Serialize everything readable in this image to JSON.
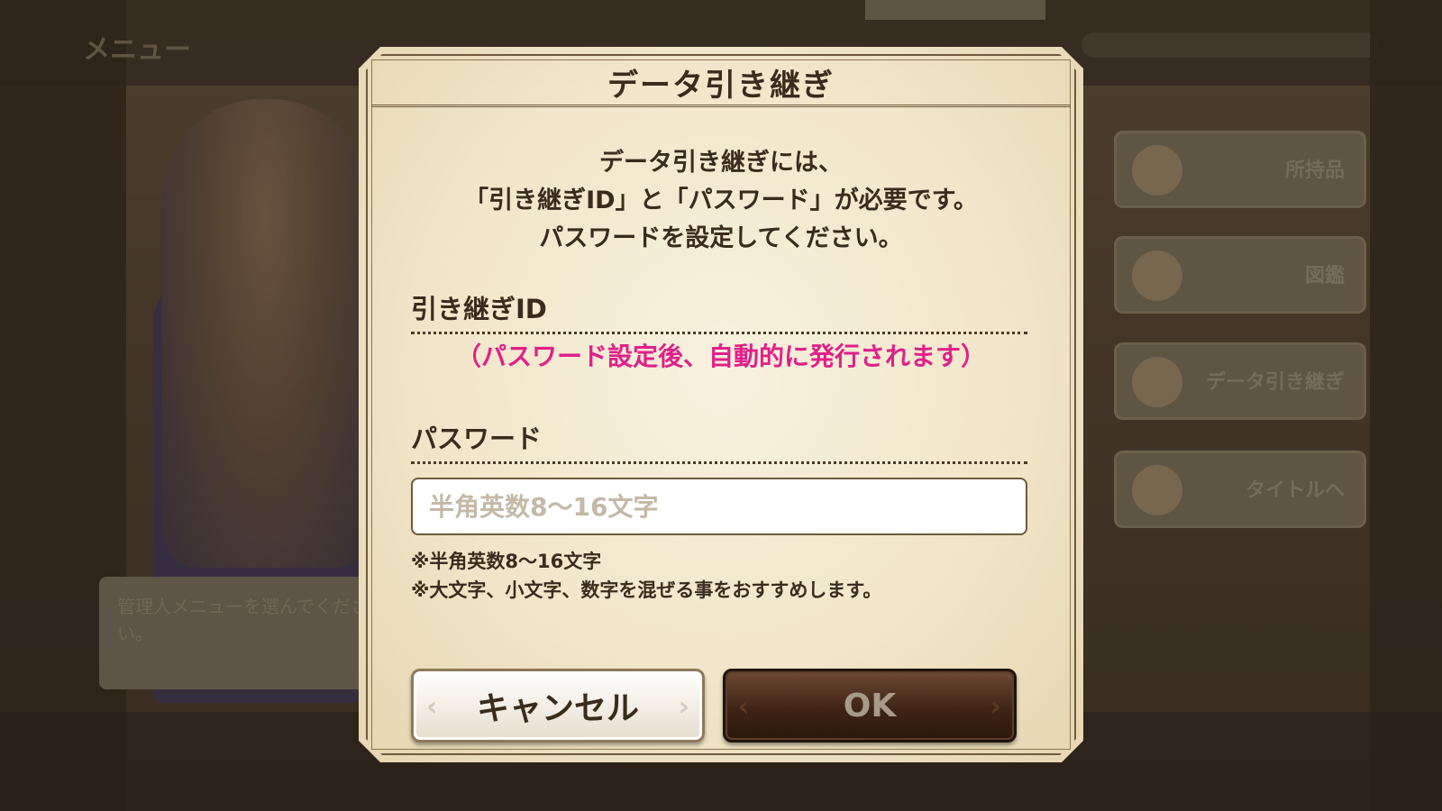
{
  "background": {
    "menu_title": "メニュー",
    "side_buttons": [
      "所持品",
      "図鑑",
      "データ引き継ぎ",
      "タイトルへ"
    ],
    "message": "管理人メニューを選んでください。"
  },
  "dialog": {
    "title": "データ引き継ぎ",
    "description": [
      "データ引き継ぎには、",
      "「引き継ぎID」と「パスワード」が必要です。",
      "パスワードを設定してください。"
    ],
    "id_section": {
      "label": "引き継ぎID",
      "value": "（パスワード設定後、自動的に発行されます）",
      "value_color": "#e0208a"
    },
    "password_section": {
      "label": "パスワード",
      "input_value": "",
      "placeholder": "半角英数8～16文字"
    },
    "notes": [
      "※半角英数8～16文字",
      "※大文字、小文字、数字を混ぜる事をおすすめします。"
    ],
    "buttons": {
      "cancel_label": "キャンセル",
      "ok_label": "OK"
    },
    "icons": {
      "chevron_left": "chevron-left-icon",
      "chevron_right": "chevron-right-icon"
    }
  }
}
